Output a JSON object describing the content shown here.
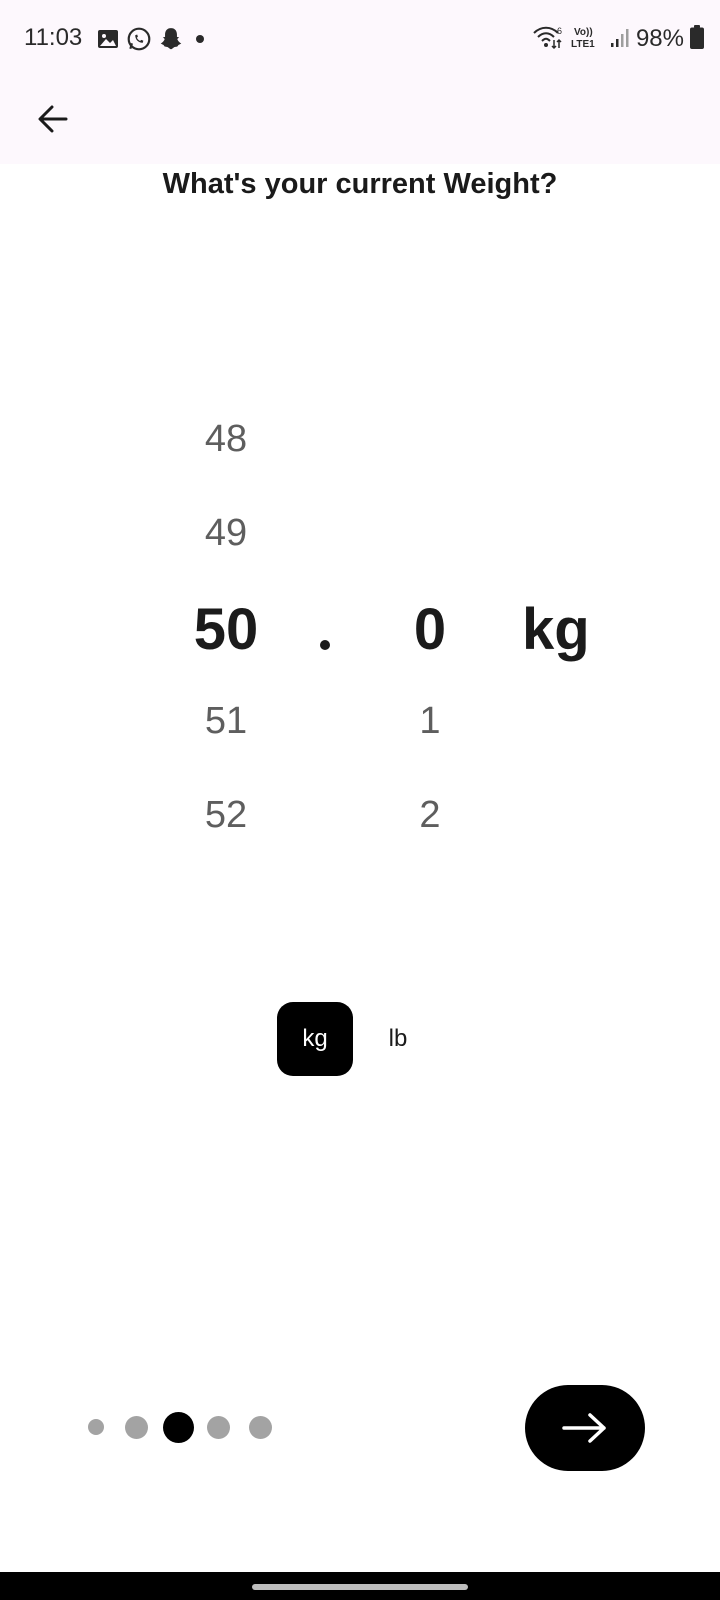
{
  "status_bar": {
    "time": "11:03",
    "battery": "98%",
    "network_label": "LTE1",
    "wifi_label": "6",
    "volte_label": "Vo))"
  },
  "header": {
    "title": "What's your current Weight?"
  },
  "picker": {
    "integer_items": [
      "48",
      "49",
      "50",
      "51",
      "52"
    ],
    "decimal_items": [
      "",
      "",
      "0",
      "1",
      "2"
    ],
    "separator": ".",
    "unit": "kg"
  },
  "unit_toggle": {
    "options": [
      "kg",
      "lb"
    ],
    "selected": "kg"
  },
  "pager": {
    "total": 5,
    "active_index": 2
  },
  "colors": {
    "accent": "#000000",
    "inactive_dot": "#a3a3a3",
    "app_bar": "#fdf8fd"
  }
}
